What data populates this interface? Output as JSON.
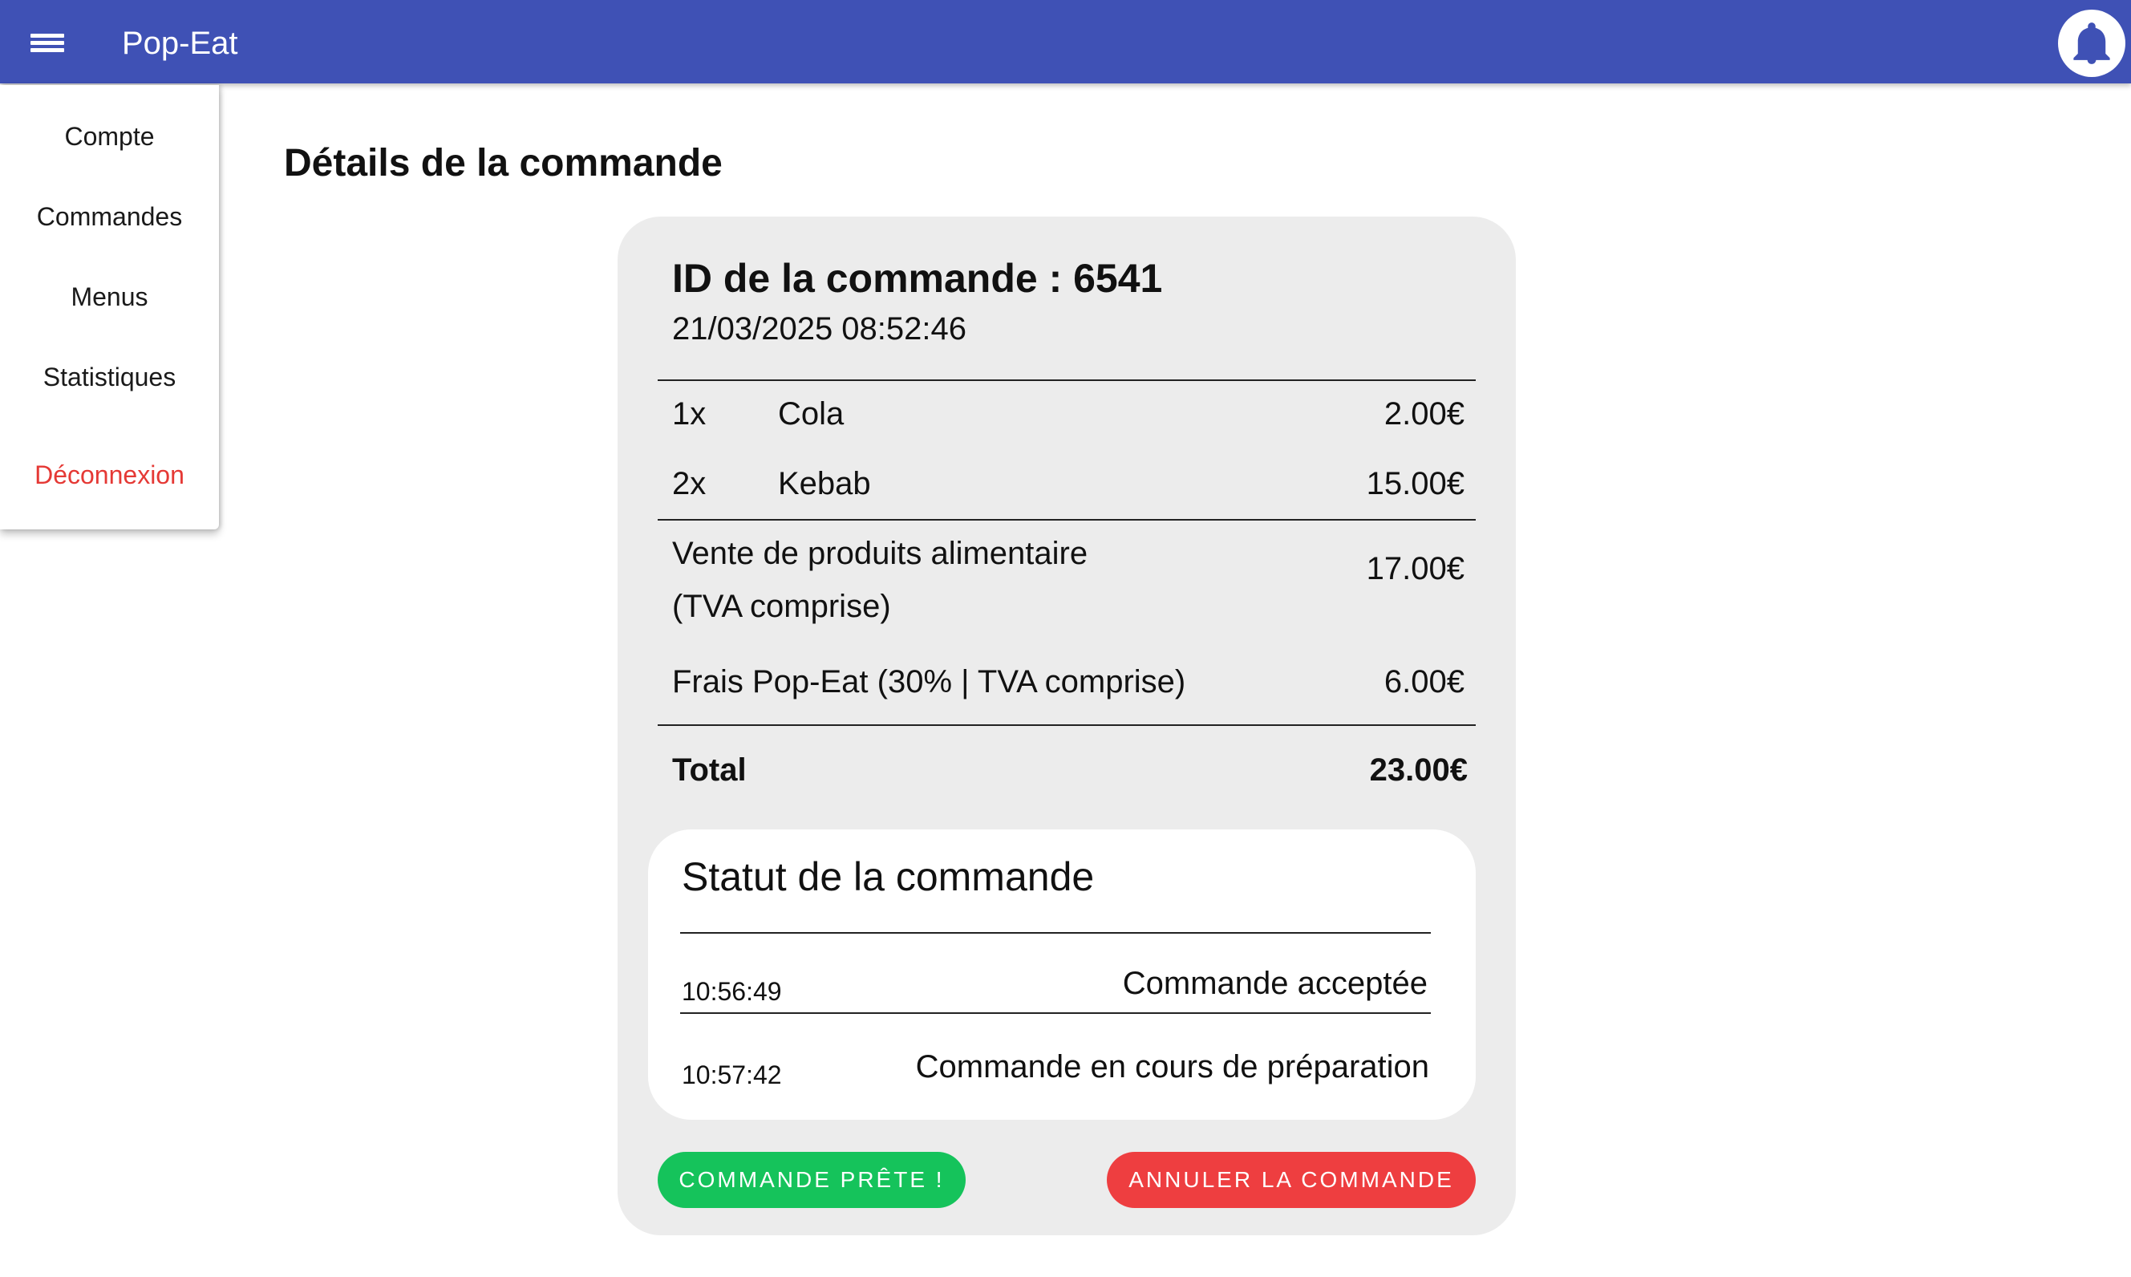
{
  "app": {
    "title": "Pop-Eat",
    "menu_icon": "hamburger-menu-icon",
    "notification_icon": "bell-icon"
  },
  "drawer": {
    "items": [
      {
        "label": "Compte"
      },
      {
        "label": "Commandes"
      },
      {
        "label": "Menus"
      },
      {
        "label": "Statistiques"
      }
    ],
    "logout_label": "Déconnexion"
  },
  "page": {
    "title": "Détails de la commande"
  },
  "order": {
    "id_text": "ID de la commande : 6541",
    "datetime": "21/03/2025 08:52:46",
    "items": [
      {
        "qty": "1x",
        "name": "Cola",
        "price": "2.00€"
      },
      {
        "qty": "2x",
        "name": "Kebab",
        "price": "15.00€"
      }
    ],
    "food_sales_label_line1": "Vente de produits alimentaire",
    "food_sales_label_line2": "(TVA comprise)",
    "food_sales_amount": "17.00€",
    "fees_label": "Frais Pop-Eat (30% | TVA comprise)",
    "fees_amount": "6.00€",
    "total_label": "Total",
    "total_amount": "23.00€"
  },
  "status": {
    "title": "Statut de la commande",
    "events": [
      {
        "time": "10:56:49",
        "label": "Commande acceptée"
      },
      {
        "time": "10:57:42",
        "label": "Commande en cours de préparation"
      }
    ]
  },
  "actions": {
    "ready_label": "COMMANDE PRÊTE !",
    "cancel_label": "ANNULER LA COMMANDE"
  },
  "colors": {
    "appbar": "#3f51b5",
    "ready": "#15c35b",
    "cancel": "#ee3e40",
    "logout": "#e53935",
    "card": "#ececec"
  }
}
